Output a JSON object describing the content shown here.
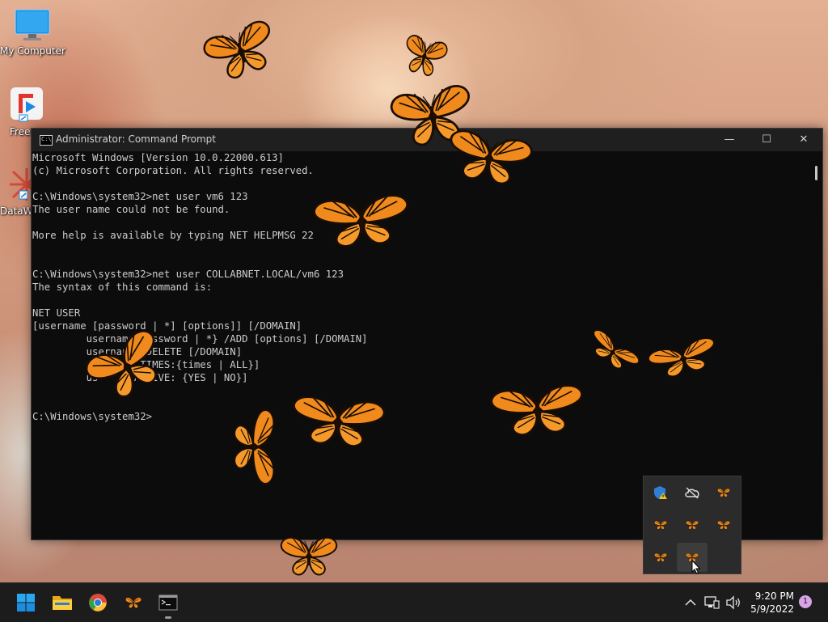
{
  "desktop": {
    "icons": [
      {
        "label": "My Computer"
      },
      {
        "label": "Free"
      },
      {
        "label": "DataW"
      }
    ]
  },
  "cmd_window": {
    "title": "Administrator: Command Prompt",
    "icon_text": "C:\\",
    "lines": [
      "Microsoft Windows [Version 10.0.22000.613]",
      "(c) Microsoft Corporation. All rights reserved.",
      "",
      "C:\\Windows\\system32>net user vm6 123",
      "The user name could not be found.",
      "",
      "More help is available by typing NET HELPMSG 22",
      "",
      "",
      "C:\\Windows\\system32>net user COLLABNET.LOCAL/vm6 123",
      "The syntax of this command is:",
      "",
      "NET USER",
      "[username [password | *] [options]] [/DOMAIN]",
      "         username password | *} /ADD [options] [/DOMAIN]",
      "         username /DELETE [/DOMAIN]",
      "         username TIMES:{times | ALL}]",
      "         us      ACTIVE: {YES | NO}]",
      "",
      "",
      "C:\\Windows\\system32>"
    ],
    "buttons": {
      "minimize": "—",
      "maximize": "☐",
      "close": "✕"
    }
  },
  "tray_flyout": {
    "icons": [
      "defender-warning-icon",
      "onedrive-offline-icon",
      "butterfly-icon",
      "butterfly-icon",
      "butterfly-icon",
      "butterfly-icon",
      "butterfly-icon",
      "butterfly-icon"
    ]
  },
  "taskbar": {
    "apps": [
      "start-icon",
      "file-explorer-icon",
      "chrome-icon",
      "butterfly-app-icon",
      "terminal-icon"
    ],
    "time": "9:20 PM",
    "date": "5/9/2022",
    "notification_count": "1"
  },
  "colors": {
    "console_bg": "#0c0c0c",
    "console_text": "#cccccc",
    "taskbar_bg": "#1c1c1c",
    "butterfly_orange": "#f28a1a"
  }
}
